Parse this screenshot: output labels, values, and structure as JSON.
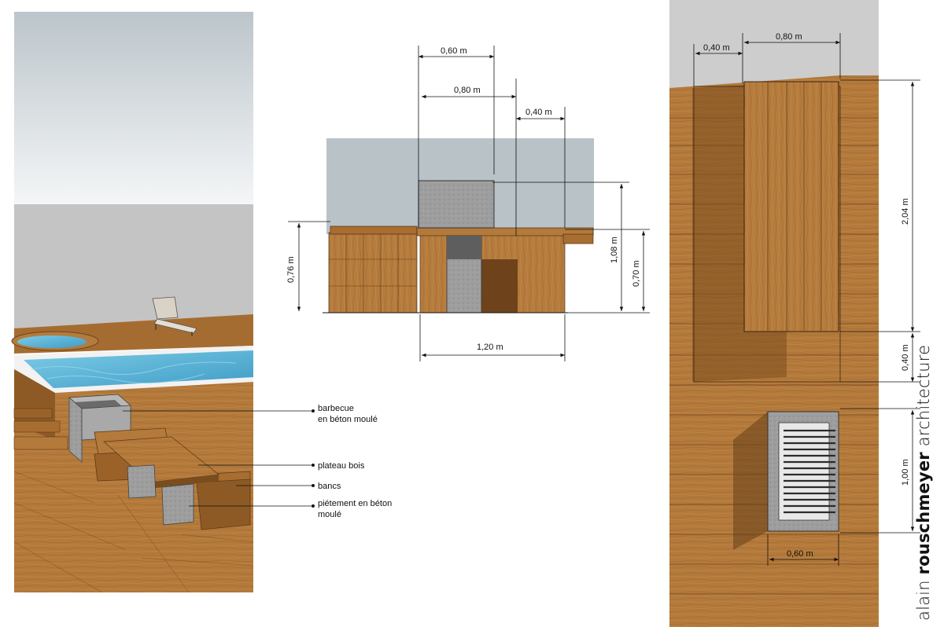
{
  "perspective_labels": {
    "barbecue_line1": "barbecue",
    "barbecue_line2": "en béton moulé",
    "plateau": "plateau bois",
    "bancs": "bancs",
    "pietement_line1": "piétement en béton",
    "pietement_line2": "moulé"
  },
  "elevation_dims": {
    "top_width": "0,60 m",
    "mid_width": "0,80 m",
    "right_width": "0,40 m",
    "bottom_width": "1,20 m",
    "left_height": "0,76 m",
    "total_height": "1,08 m",
    "right_height": "0,70 m"
  },
  "plan_dims": {
    "top_left": "0,40 m",
    "top_right": "0,80 m",
    "length": "2,04 m",
    "gap": "0,40 m",
    "bbq_length": "1,00 m",
    "bbq_width": "0,60 m"
  },
  "brand": {
    "first": "alain",
    "name": "rouschmeyer",
    "suffix": "architecture"
  },
  "colors": {
    "wood_light": "#b9803f",
    "wood_dark": "#7a4d1f",
    "concrete": "#9c9c9c",
    "water": "#5fb6d8",
    "sky": "#c7d0d6"
  }
}
